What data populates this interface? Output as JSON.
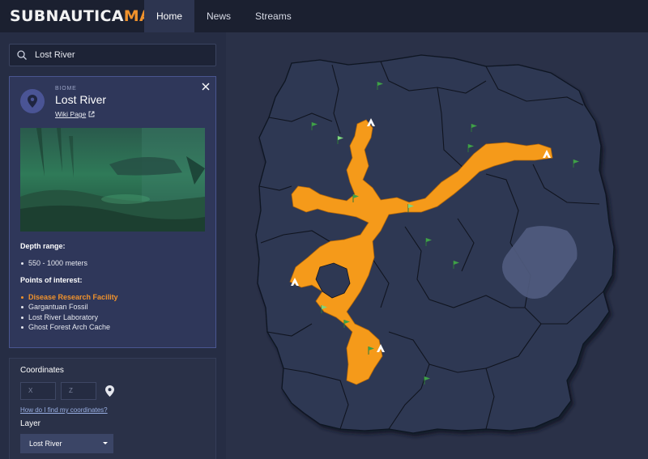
{
  "logo": {
    "part1": "SUBNAUTICA",
    "part2": "MAP"
  },
  "nav": {
    "items": [
      "Home",
      "News",
      "Streams"
    ],
    "active": "Home"
  },
  "search": {
    "value": "Lost River",
    "icon": "search-icon"
  },
  "biome": {
    "label": "BIOME",
    "title": "Lost River",
    "wiki_label": "Wiki Page",
    "depth_heading": "Depth range:",
    "depth_value": "550 - 1000 meters",
    "poi_heading": "Points of interest:",
    "poi": [
      "Disease Research Facility",
      "Gargantuan Fossil",
      "Lost River Laboratory",
      "Ghost Forest Arch Cache"
    ]
  },
  "coordinates": {
    "title": "Coordinates",
    "x_placeholder": "X",
    "z_placeholder": "Z",
    "help_link": "How do I find my coordinates?"
  },
  "layer": {
    "title": "Layer",
    "selected": "Lost River"
  },
  "colors": {
    "accent": "#f0922c",
    "background": "#2a3148",
    "topbar": "#1b2030",
    "land": "#2e3853",
    "biome_highlight": "#f59a1a",
    "flag": "#3fa048"
  }
}
